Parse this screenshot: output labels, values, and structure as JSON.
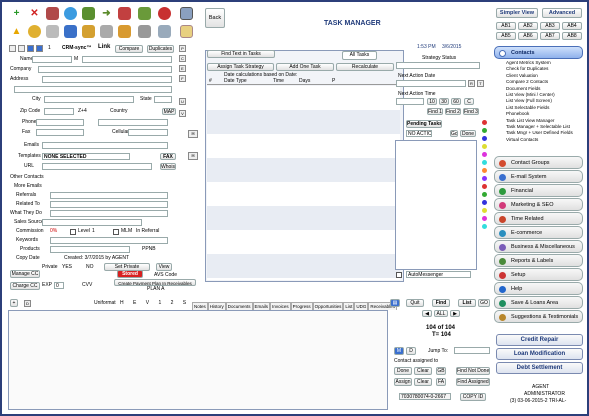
{
  "header": {
    "title": "TASK MANAGER",
    "back_label": "Back",
    "simpler_view": "Simpler View",
    "advanced": "Advanced"
  },
  "ab_buttons": [
    "AB1",
    "AB2",
    "AB3",
    "AB4",
    "AB5",
    "AB6",
    "AB7",
    "AB8"
  ],
  "contact_form": {
    "crm_label": "CRM-sync™",
    "link_label": "Link",
    "compare_label": "Compare",
    "duplicates_label": "Duplicates",
    "name_label": "Name",
    "company_label": "Company",
    "address_label": "Address",
    "city_label": "City",
    "state_label": "State",
    "zip_label": "Zip Code",
    "country_label": "Country",
    "map_label": "MAP",
    "phones_label": "Phones",
    "fax_label": "Fax",
    "cellular_label": "Cellular",
    "emails_label": "Emails",
    "templates_label": "Templates",
    "templates_value": "NONE SELECTED",
    "fax_btn": "FAX",
    "url_label": "URL",
    "whois_label": "Whois",
    "other_contacts": "Other Contacts",
    "more_emails": "More Emails",
    "referrals_label": "Referrals",
    "related_to_label": "Related To",
    "what_they_do_label": "What They Do",
    "sales_source_label": "Sales Source",
    "commission_label": "Commission",
    "commission_value": "0%",
    "level_label": "Level",
    "level_value": "1",
    "mlm_label": "MLM",
    "in_referral_label": "In Referral",
    "keywords_label": "Keywords",
    "products_label": "Products",
    "ppnb_label": "PPNB",
    "copy_date_label": "Copy Date",
    "created_label": "Created: 3/7/2015 by AGENT",
    "private_label": "Private",
    "yes_label": "YES",
    "no_label": "NO",
    "set_private": "Set Private",
    "view_label": "View",
    "manage_cc": "Manage CC",
    "stored_label": "Stored",
    "avs_code": "AVS Code",
    "charge_cc": "Charge CC",
    "exp_label": "EXP",
    "exp_value": "0",
    "cvv_label": "CVV",
    "payment_plan": "Create Payment Plan In Receivables",
    "plan_label": "PLAN A",
    "uniformat_label": "Uniformat",
    "letters": [
      "A",
      "B",
      "C",
      "D",
      "E",
      "F",
      "G",
      "H",
      "I",
      "J",
      "K",
      "L",
      "M",
      "N",
      "O",
      "P",
      "Q",
      "R",
      "S",
      "T"
    ],
    "side_letters": [
      "P",
      "C",
      "E",
      "F",
      "U",
      "V"
    ]
  },
  "tabs": [
    "Notes",
    "History",
    "Documents",
    "Emails",
    "Invoices",
    "Progress",
    "Opportunities",
    "List",
    "UDG",
    "Receivables"
  ],
  "tasks": {
    "find_text": "Find Text in Tasks",
    "all_tasks": "All Tasks",
    "assign_strategy": "Assign Task Strategy",
    "add_one_task": "Add One Task",
    "recalculate": "Recalculate",
    "calc_note": "Date calculations based on Date:",
    "columns": [
      "#",
      "Date Type",
      "Time",
      "Days",
      "P"
    ]
  },
  "strategy": {
    "time": "1:53 PM",
    "date": "3/6/2015",
    "strategy_status": "Strategy Status",
    "next_action_date": "Next Action Date",
    "next_action_time": "Next Action Time",
    "time_steps": [
      "10",
      "30",
      "60"
    ],
    "c_label": "C",
    "find_buttons": [
      "Find 1",
      "Find 2",
      "Find 3"
    ],
    "pending_tasks": "Pending Tasks",
    "no_action": "NO ACTION",
    "go_label": "Go",
    "done_label": "Done",
    "auto_messenger": "AutoMessenger",
    "side_letters": [
      "A",
      "B",
      "C",
      "D",
      "E",
      "F",
      "G",
      "H",
      "I",
      "J",
      "K",
      "L",
      "M",
      "N",
      "O",
      "P",
      "Q",
      "R",
      "S",
      "T"
    ]
  },
  "nav_bottom": {
    "quit": "Quit",
    "find": "Find",
    "list": "List",
    "go_label": "GO",
    "all_label": "ALL",
    "record": "104 of 104",
    "total": "T= 104",
    "m": "M",
    "d": "D",
    "jump_to": "Jump To:",
    "contact_assigned": "Contact assigned to",
    "done": "Done",
    "clear": "Clear",
    "gb": "GB",
    "find_not_done": "Find Not Done",
    "assign": "Assign",
    "clear2": "Clear",
    "fa": "FA",
    "find_assigned": "Find Assigned",
    "code_value": "7030780074-0-2667",
    "copy_id": "COPY ID"
  },
  "sidebar": {
    "contacts": "Contacts",
    "contact_items": [
      "Agent Metrics System",
      "Check for Duplicates",
      "Client Valuation",
      "Compare 2 Contacts",
      "Document Fields",
      "List View (Mini / Center)",
      "List View (Full Screen)",
      "List Selectable Fields",
      "Phonebook",
      "Task List View Manager",
      "Task Manager + Selectable List",
      "Task Mngr + User Defined Fields",
      "Virtual Contacts"
    ],
    "groups": [
      {
        "label": "Contact Groups",
        "color": "#d34b2f"
      },
      {
        "label": "E-mail System",
        "color": "#3a6fcf"
      },
      {
        "label": "Financial",
        "color": "#2d9a3e"
      },
      {
        "label": "Marketing & SEO",
        "color": "#d23a7a"
      },
      {
        "label": "Time Related",
        "color": "#c9452b"
      },
      {
        "label": "E-commerce",
        "color": "#2a8fbf"
      },
      {
        "label": "Business & Miscellaneous",
        "color": "#7a5cb8"
      },
      {
        "label": "Reports & Labels",
        "color": "#4a8a3a"
      },
      {
        "label": "Setup",
        "color": "#cc3333"
      },
      {
        "label": "Help",
        "color": "#2266cc"
      },
      {
        "label": "Save & Loans Area",
        "color": "#1f8f5f"
      },
      {
        "label": "Suggestions & Testimonials",
        "color": "#b8862b"
      }
    ],
    "credit_repair": "Credit Repair",
    "loan_modification": "Loan Modification",
    "debt_settlement": "Debt Settlement",
    "user": "AGENT",
    "role": "ADMINISTRATOR",
    "version": "(3) 03-06-2015-2 TRI-AL-"
  }
}
